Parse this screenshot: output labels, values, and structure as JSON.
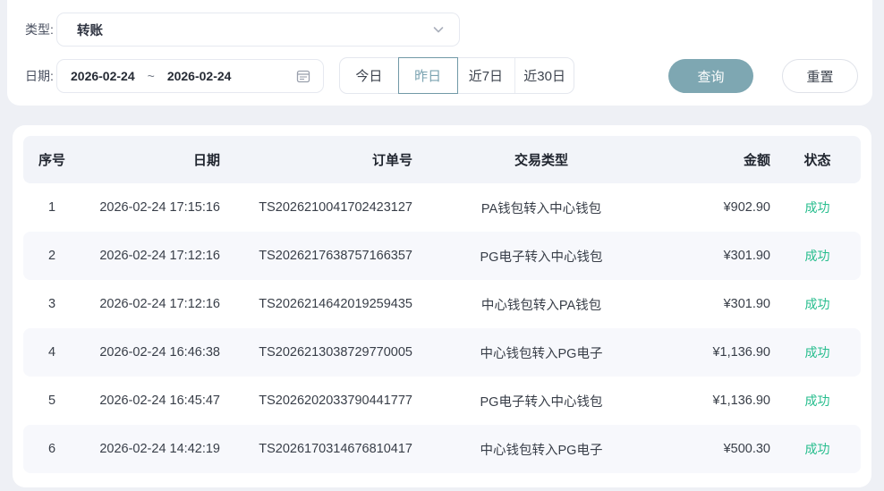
{
  "filters": {
    "type_label": "类型:",
    "type_value": "转账",
    "date_label": "日期:",
    "date_start": "2026-02-24",
    "date_separator": "~",
    "date_end": "2026-02-24",
    "quick_ranges": [
      {
        "label": "今日",
        "selected": false
      },
      {
        "label": "昨日",
        "selected": true
      },
      {
        "label": "近7日",
        "selected": false
      },
      {
        "label": "近30日",
        "selected": false
      }
    ],
    "query_label": "查询",
    "reset_label": "重置"
  },
  "table": {
    "columns": [
      {
        "key": "index",
        "label": "序号",
        "align": "center"
      },
      {
        "key": "date",
        "label": "日期",
        "align": "right"
      },
      {
        "key": "order_no",
        "label": "订单号",
        "align": "right"
      },
      {
        "key": "type",
        "label": "交易类型",
        "align": "center"
      },
      {
        "key": "amount",
        "label": "金额",
        "align": "right"
      },
      {
        "key": "status",
        "label": "状态",
        "align": "center"
      }
    ],
    "rows": [
      {
        "index": "1",
        "date": "2026-02-24 17:15:16",
        "order_no": "TS2026210041702423127",
        "type": "PA钱包转入中心钱包",
        "amount": "¥902.90",
        "status": "成功"
      },
      {
        "index": "2",
        "date": "2026-02-24 17:12:16",
        "order_no": "TS2026217638757166357",
        "type": "PG电子转入中心钱包",
        "amount": "¥301.90",
        "status": "成功"
      },
      {
        "index": "3",
        "date": "2026-02-24 17:12:16",
        "order_no": "TS2026214642019259435",
        "type": "中心钱包转入PA钱包",
        "amount": "¥301.90",
        "status": "成功"
      },
      {
        "index": "4",
        "date": "2026-02-24 16:46:38",
        "order_no": "TS2026213038729770005",
        "type": "中心钱包转入PG电子",
        "amount": "¥1,136.90",
        "status": "成功"
      },
      {
        "index": "5",
        "date": "2026-02-24 16:45:47",
        "order_no": "TS2026202033790441777",
        "type": "PG电子转入中心钱包",
        "amount": "¥1,136.90",
        "status": "成功"
      },
      {
        "index": "6",
        "date": "2026-02-24 14:42:19",
        "order_no": "TS2026170314676810417",
        "type": "中心钱包转入PG电子",
        "amount": "¥500.30",
        "status": "成功"
      }
    ]
  },
  "icons": {
    "select_chevron": "chevron-down-icon",
    "date_picker": "calendar-icon"
  },
  "colors": {
    "accent_teal": "#7ea7b2",
    "success_green": "#26bd8d",
    "page_bg": "#eef0f5",
    "selected_range_border": "#7199a7"
  }
}
